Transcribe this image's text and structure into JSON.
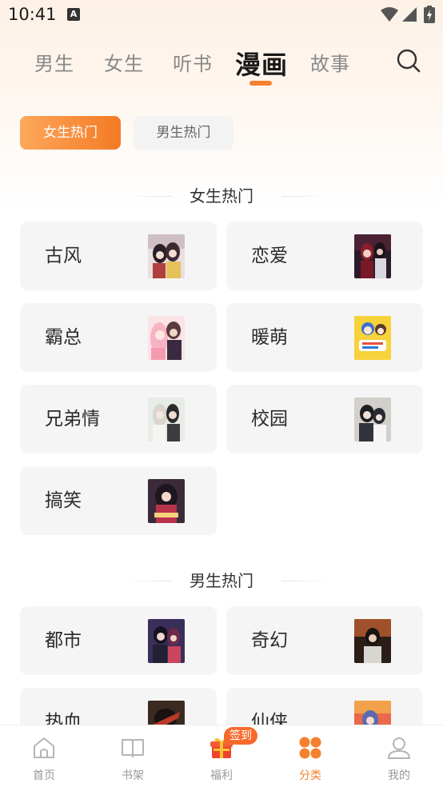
{
  "status_bar": {
    "time": "10:41",
    "notification_icon": "A"
  },
  "top_tabs": {
    "items": [
      {
        "label": "男生",
        "icon": "",
        "active": false
      },
      {
        "label": "女生",
        "icon": "",
        "active": false
      },
      {
        "label": "听书",
        "icon": "",
        "active": false
      },
      {
        "label": "漫画",
        "icon": "",
        "active": true
      },
      {
        "label": "故事",
        "icon": "",
        "active": false
      }
    ],
    "search_icon": "search-icon",
    "accent_color": "#f5812f"
  },
  "filter_chips": {
    "female_label": "女生热门",
    "male_label": "男生热门",
    "selected": "女生热门"
  },
  "female_section": {
    "title": "女生热门",
    "categories": [
      {
        "label": "古风"
      },
      {
        "label": "恋爱"
      },
      {
        "label": "霸总"
      },
      {
        "label": "暖萌"
      },
      {
        "label": "兄弟情"
      },
      {
        "label": "校园"
      },
      {
        "label": "搞笑"
      }
    ]
  },
  "male_section": {
    "title": "男生热门",
    "categories": [
      {
        "label": "都市"
      },
      {
        "label": "奇幻"
      },
      {
        "label": "热血"
      },
      {
        "label": "仙侠"
      }
    ]
  },
  "bottom_nav": {
    "items": [
      {
        "label": "首页",
        "icon": "home-icon",
        "active": false
      },
      {
        "label": "书架",
        "icon": "bookshelf-icon",
        "active": false
      },
      {
        "label": "福利",
        "icon": "gift-icon",
        "active": false
      },
      {
        "label": "分类",
        "icon": "category-icon",
        "active": true
      },
      {
        "label": "我的",
        "icon": "profile-icon",
        "active": false
      }
    ],
    "signin_badge": "签到",
    "active_color": "#f5812f"
  }
}
